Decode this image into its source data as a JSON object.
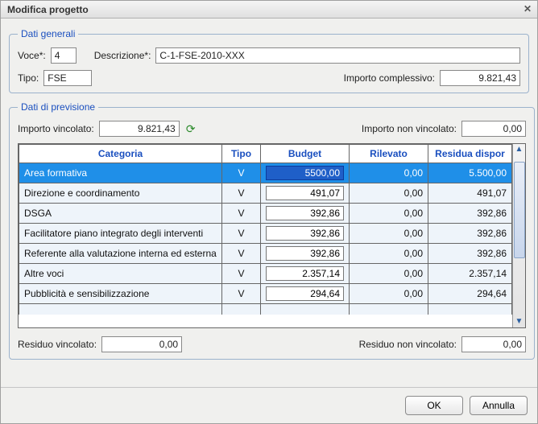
{
  "window": {
    "title": "Modifica progetto"
  },
  "generali": {
    "legend": "Dati generali",
    "voce_label": "Voce*:",
    "voce_value": "4",
    "descrizione_label": "Descrizione*:",
    "descrizione_value": "C-1-FSE-2010-XXX",
    "tipo_label": "Tipo:",
    "tipo_value": "FSE",
    "importo_complessivo_label": "Importo complessivo:",
    "importo_complessivo_value": "9.821,43"
  },
  "previsione": {
    "legend": "Dati di previsione",
    "importo_vincolato_label": "Importo vincolato:",
    "importo_vincolato_value": "9.821,43",
    "importo_non_vincolato_label": "Importo non vincolato:",
    "importo_non_vincolato_value": "0,00",
    "residuo_vincolato_label": "Residuo vincolato:",
    "residuo_vincolato_value": "0,00",
    "residuo_non_vincolato_label": "Residuo non vincolato:",
    "residuo_non_vincolato_value": "0,00",
    "headers": {
      "categoria": "Categoria",
      "tipo": "Tipo",
      "budget": "Budget",
      "rilevato": "Rilevato",
      "residua": "Residua dispor"
    },
    "rows": [
      {
        "categoria": "Area formativa",
        "tipo": "V",
        "budget": "5500,00",
        "rilevato": "0,00",
        "residua": "5.500,00",
        "selected": true
      },
      {
        "categoria": "Direzione e coordinamento",
        "tipo": "V",
        "budget": "491,07",
        "rilevato": "0,00",
        "residua": "491,07"
      },
      {
        "categoria": "DSGA",
        "tipo": "V",
        "budget": "392,86",
        "rilevato": "0,00",
        "residua": "392,86"
      },
      {
        "categoria": "Facilitatore piano integrato degli interventi",
        "tipo": "V",
        "budget": "392,86",
        "rilevato": "0,00",
        "residua": "392,86"
      },
      {
        "categoria": "Referente alla valutazione interna ed esterna",
        "tipo": "V",
        "budget": "392,86",
        "rilevato": "0,00",
        "residua": "392,86"
      },
      {
        "categoria": "Altre voci",
        "tipo": "V",
        "budget": "2.357,14",
        "rilevato": "0,00",
        "residua": "2.357,14"
      },
      {
        "categoria": "Pubblicità e sensibilizzazione",
        "tipo": "V",
        "budget": "294,64",
        "rilevato": "0,00",
        "residua": "294,64"
      }
    ]
  },
  "buttons": {
    "ok": "OK",
    "annulla": "Annulla"
  }
}
